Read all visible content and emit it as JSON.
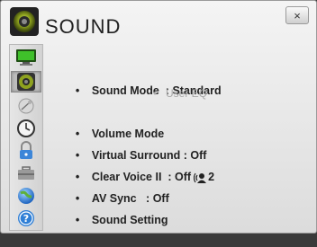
{
  "window": {
    "title": "SOUND",
    "close_label": "×"
  },
  "sidebar": {
    "items": [
      {
        "name": "picture",
        "icon": "monitor-icon"
      },
      {
        "name": "sound",
        "icon": "speaker-icon",
        "active": true
      },
      {
        "name": "channel",
        "icon": "satellite-dish-icon"
      },
      {
        "name": "time",
        "icon": "clock-icon"
      },
      {
        "name": "lock",
        "icon": "padlock-icon"
      },
      {
        "name": "option",
        "icon": "toolbox-icon"
      },
      {
        "name": "network",
        "icon": "globe-icon"
      },
      {
        "name": "support",
        "icon": "question-icon"
      }
    ]
  },
  "menu": {
    "bullet": "•",
    "items": [
      {
        "label": "Sound Mode",
        "sep": "  : ",
        "value": "Standard"
      },
      {
        "label": "User EQ"
      },
      {
        "label": "Volume Mode"
      },
      {
        "label": "Virtual Surround",
        "sep": " : ",
        "value": "Off"
      },
      {
        "label": "Clear Voice II",
        "sep": "  : ",
        "value": "Off",
        "suffix": "2"
      },
      {
        "label": "AV Sync",
        "sep": "   : ",
        "value": "Off"
      },
      {
        "label": "Sound Setting"
      }
    ]
  },
  "colors": {
    "accent_green": "#7a8c1e",
    "disabled_text": "#a8a8a8"
  }
}
